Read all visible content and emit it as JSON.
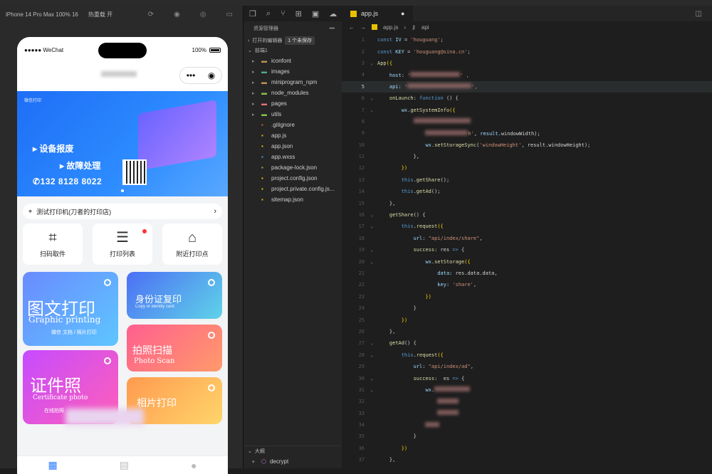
{
  "simulator": {
    "device": "iPhone 14 Pro Max 100% 16",
    "hot_reload": "热重载 开"
  },
  "phone": {
    "carrier": "WeChat",
    "battery": "100%",
    "banner": {
      "small": "微信打印",
      "line1": "设备报废",
      "line2": "故障处理",
      "phone": "132 8128 8022"
    },
    "address": "测试打印机(刀者的打印店)",
    "quick": [
      {
        "label": "扫码取件",
        "icon": "scan-icon"
      },
      {
        "label": "打印列表",
        "icon": "list-icon"
      },
      {
        "label": "附近打印点",
        "icon": "home-location-icon"
      }
    ],
    "tiles": {
      "t1": {
        "title": "图文打印",
        "en": "Graphic printing",
        "sub": "微信 文档 / 照片打印"
      },
      "t2": {
        "title": "身份证复印",
        "en": "Copy of identity card"
      },
      "t3": {
        "title": "拍照扫描",
        "en": "Photo Scan"
      },
      "t4": {
        "title": "证件照",
        "en": "Certificate photo",
        "sub": "在线拍照"
      },
      "t5": {
        "title": "相片打印"
      }
    }
  },
  "explorer": {
    "header": "资源管理器",
    "open_editors": "打开的编辑器",
    "unsaved": "1 个未保存",
    "project": "前端1",
    "items": [
      {
        "name": "iconfont",
        "type": "folder",
        "color": "#c09553"
      },
      {
        "name": "images",
        "type": "folder",
        "color": "#4caf8a"
      },
      {
        "name": "miniprogram_npm",
        "type": "folder",
        "color": "#c09553"
      },
      {
        "name": "node_modules",
        "type": "folder",
        "color": "#8bc34a"
      },
      {
        "name": "pages",
        "type": "folder",
        "color": "#e57373"
      },
      {
        "name": "utils",
        "type": "folder",
        "color": "#8bc34a"
      },
      {
        "name": ".gitignore",
        "type": "file",
        "color": "#e55a2b"
      },
      {
        "name": "app.js",
        "type": "file",
        "color": "#e8c000"
      },
      {
        "name": "app.json",
        "type": "file",
        "color": "#e8c000"
      },
      {
        "name": "app.wxss",
        "type": "file",
        "color": "#42a5f5"
      },
      {
        "name": "package-lock.json",
        "type": "file",
        "color": "#8bc34a"
      },
      {
        "name": "project.config.json",
        "type": "file",
        "color": "#e8c000"
      },
      {
        "name": "project.private.config.js...",
        "type": "file",
        "color": "#e8c000"
      },
      {
        "name": "sitemap.json",
        "type": "file",
        "color": "#e8c000"
      }
    ],
    "outline": "大纲",
    "outline_item": "decrypt"
  },
  "editor": {
    "tab": "app.js",
    "breadcrumb_file": "app.js",
    "breadcrumb_symbol": "api",
    "lines": [
      [
        {
          "c": "kw2",
          "t": "const "
        },
        {
          "c": "id",
          "t": "IV"
        },
        {
          "c": "t",
          "t": " = "
        },
        {
          "c": "str",
          "t": "'houguang'"
        },
        {
          "c": "t",
          "t": ";"
        }
      ],
      [
        {
          "c": "kw2",
          "t": "const "
        },
        {
          "c": "id",
          "t": "KEY"
        },
        {
          "c": "t",
          "t": " = "
        },
        {
          "c": "str",
          "t": "'houguang@sina.cn'"
        },
        {
          "c": "t",
          "t": ";"
        }
      ],
      [
        {
          "c": "fn",
          "t": "App"
        },
        {
          "c": "p",
          "t": "({"
        }
      ],
      [
        {
          "c": "t",
          "t": "    "
        },
        {
          "c": "id",
          "t": "host"
        },
        {
          "c": "t",
          "t": ": "
        },
        {
          "c": "str",
          "t": "'"
        },
        {
          "c": "blur",
          "t": "70"
        },
        {
          "c": "str",
          "t": "' ,"
        }
      ],
      [
        {
          "c": "t",
          "t": "    "
        },
        {
          "c": "id",
          "t": "api"
        },
        {
          "c": "t",
          "t": ": "
        },
        {
          "c": "str",
          "t": "'"
        },
        {
          "c": "blur",
          "t": "90"
        },
        {
          "c": "str",
          "t": "',"
        }
      ],
      [
        {
          "c": "t",
          "t": "    "
        },
        {
          "c": "fn",
          "t": "onLaunch"
        },
        {
          "c": "t",
          "t": ": "
        },
        {
          "c": "kw2",
          "t": "function"
        },
        {
          "c": "t",
          "t": " () {"
        }
      ],
      [
        {
          "c": "t",
          "t": "        "
        },
        {
          "c": "id",
          "t": "wx"
        },
        {
          "c": "t",
          "t": "."
        },
        {
          "c": "fn",
          "t": "getSystemInfo"
        },
        {
          "c": "p",
          "t": "({"
        }
      ],
      [
        {
          "c": "t",
          "t": "            "
        },
        {
          "c": "blur",
          "t": "80"
        }
      ],
      [
        {
          "c": "t",
          "t": "                "
        },
        {
          "c": "blur",
          "t": "60"
        },
        {
          "c": "str",
          "t": "h'"
        },
        {
          "c": "t",
          "t": ", "
        },
        {
          "c": "id",
          "t": "result"
        },
        {
          "c": "t",
          "t": ".windowWidth);"
        }
      ],
      [
        {
          "c": "t",
          "t": "                "
        },
        {
          "c": "id",
          "t": "wx"
        },
        {
          "c": "t",
          "t": "."
        },
        {
          "c": "fn",
          "t": "setStorageSync"
        },
        {
          "c": "t",
          "t": "("
        },
        {
          "c": "str",
          "t": "'windowHeight'"
        },
        {
          "c": "t",
          "t": ", result.windowHeight);"
        }
      ],
      [
        {
          "c": "t",
          "t": "            },"
        }
      ],
      [
        {
          "c": "t",
          "t": "        "
        },
        {
          "c": "p",
          "t": "})"
        }
      ],
      [
        {
          "c": "t",
          "t": "        "
        },
        {
          "c": "kw2",
          "t": "this"
        },
        {
          "c": "t",
          "t": "."
        },
        {
          "c": "fn",
          "t": "getShare"
        },
        {
          "c": "t",
          "t": "();"
        }
      ],
      [
        {
          "c": "t",
          "t": "        "
        },
        {
          "c": "kw2",
          "t": "this"
        },
        {
          "c": "t",
          "t": "."
        },
        {
          "c": "fn",
          "t": "getAd"
        },
        {
          "c": "t",
          "t": "();"
        }
      ],
      [
        {
          "c": "t",
          "t": "    },"
        }
      ],
      [
        {
          "c": "t",
          "t": "    "
        },
        {
          "c": "fn",
          "t": "getShare"
        },
        {
          "c": "t",
          "t": "() {"
        }
      ],
      [
        {
          "c": "t",
          "t": "        "
        },
        {
          "c": "kw2",
          "t": "this"
        },
        {
          "c": "t",
          "t": "."
        },
        {
          "c": "fn",
          "t": "request"
        },
        {
          "c": "p",
          "t": "({"
        }
      ],
      [
        {
          "c": "t",
          "t": "            "
        },
        {
          "c": "id",
          "t": "url"
        },
        {
          "c": "t",
          "t": ": "
        },
        {
          "c": "str",
          "t": "\"api/index/share\""
        },
        {
          "c": "t",
          "t": ","
        }
      ],
      [
        {
          "c": "t",
          "t": "            "
        },
        {
          "c": "fn",
          "t": "success"
        },
        {
          "c": "t",
          "t": ": res "
        },
        {
          "c": "kw2",
          "t": "=>"
        },
        {
          "c": "t",
          "t": " {"
        }
      ],
      [
        {
          "c": "t",
          "t": "                "
        },
        {
          "c": "id",
          "t": "wx"
        },
        {
          "c": "t",
          "t": "."
        },
        {
          "c": "fn",
          "t": "setStorage"
        },
        {
          "c": "p",
          "t": "({"
        }
      ],
      [
        {
          "c": "t",
          "t": "                    "
        },
        {
          "c": "id",
          "t": "data"
        },
        {
          "c": "t",
          "t": ": res.data.data,"
        }
      ],
      [
        {
          "c": "t",
          "t": "                    "
        },
        {
          "c": "id",
          "t": "key"
        },
        {
          "c": "t",
          "t": ": "
        },
        {
          "c": "str",
          "t": "'share'"
        },
        {
          "c": "t",
          "t": ","
        }
      ],
      [
        {
          "c": "t",
          "t": "                "
        },
        {
          "c": "p",
          "t": "})"
        }
      ],
      [
        {
          "c": "t",
          "t": "            }"
        }
      ],
      [
        {
          "c": "t",
          "t": "        "
        },
        {
          "c": "p",
          "t": "})"
        }
      ],
      [
        {
          "c": "t",
          "t": "    },"
        }
      ],
      [
        {
          "c": "t",
          "t": "    "
        },
        {
          "c": "fn",
          "t": "getAd"
        },
        {
          "c": "t",
          "t": "() {"
        }
      ],
      [
        {
          "c": "t",
          "t": "        "
        },
        {
          "c": "kw2",
          "t": "this"
        },
        {
          "c": "t",
          "t": "."
        },
        {
          "c": "fn",
          "t": "request"
        },
        {
          "c": "p",
          "t": "({"
        }
      ],
      [
        {
          "c": "t",
          "t": "            "
        },
        {
          "c": "id",
          "t": "url"
        },
        {
          "c": "t",
          "t": ": "
        },
        {
          "c": "str",
          "t": "\"api/index/ad\""
        },
        {
          "c": "t",
          "t": ","
        }
      ],
      [
        {
          "c": "t",
          "t": "            "
        },
        {
          "c": "fn",
          "t": "success"
        },
        {
          "c": "t",
          "t": ":  es "
        },
        {
          "c": "kw2",
          "t": "=>"
        },
        {
          "c": "t",
          "t": " {"
        }
      ],
      [
        {
          "c": "t",
          "t": "                "
        },
        {
          "c": "id",
          "t": "wx"
        },
        {
          "c": "t",
          "t": "."
        },
        {
          "c": "blur",
          "t": "50"
        }
      ],
      [
        {
          "c": "t",
          "t": "                    "
        },
        {
          "c": "blur",
          "t": "30"
        }
      ],
      [
        {
          "c": "t",
          "t": "                    "
        },
        {
          "c": "blur",
          "t": "30"
        }
      ],
      [
        {
          "c": "t",
          "t": "                "
        },
        {
          "c": "blur",
          "t": "20"
        }
      ],
      [
        {
          "c": "t",
          "t": "            }"
        }
      ],
      [
        {
          "c": "t",
          "t": "        "
        },
        {
          "c": "p",
          "t": "})"
        }
      ],
      [
        {
          "c": "t",
          "t": "    },"
        }
      ]
    ]
  },
  "colors": {
    "accent": "#2a7bff",
    "editor_bg": "#1e1e1e"
  }
}
